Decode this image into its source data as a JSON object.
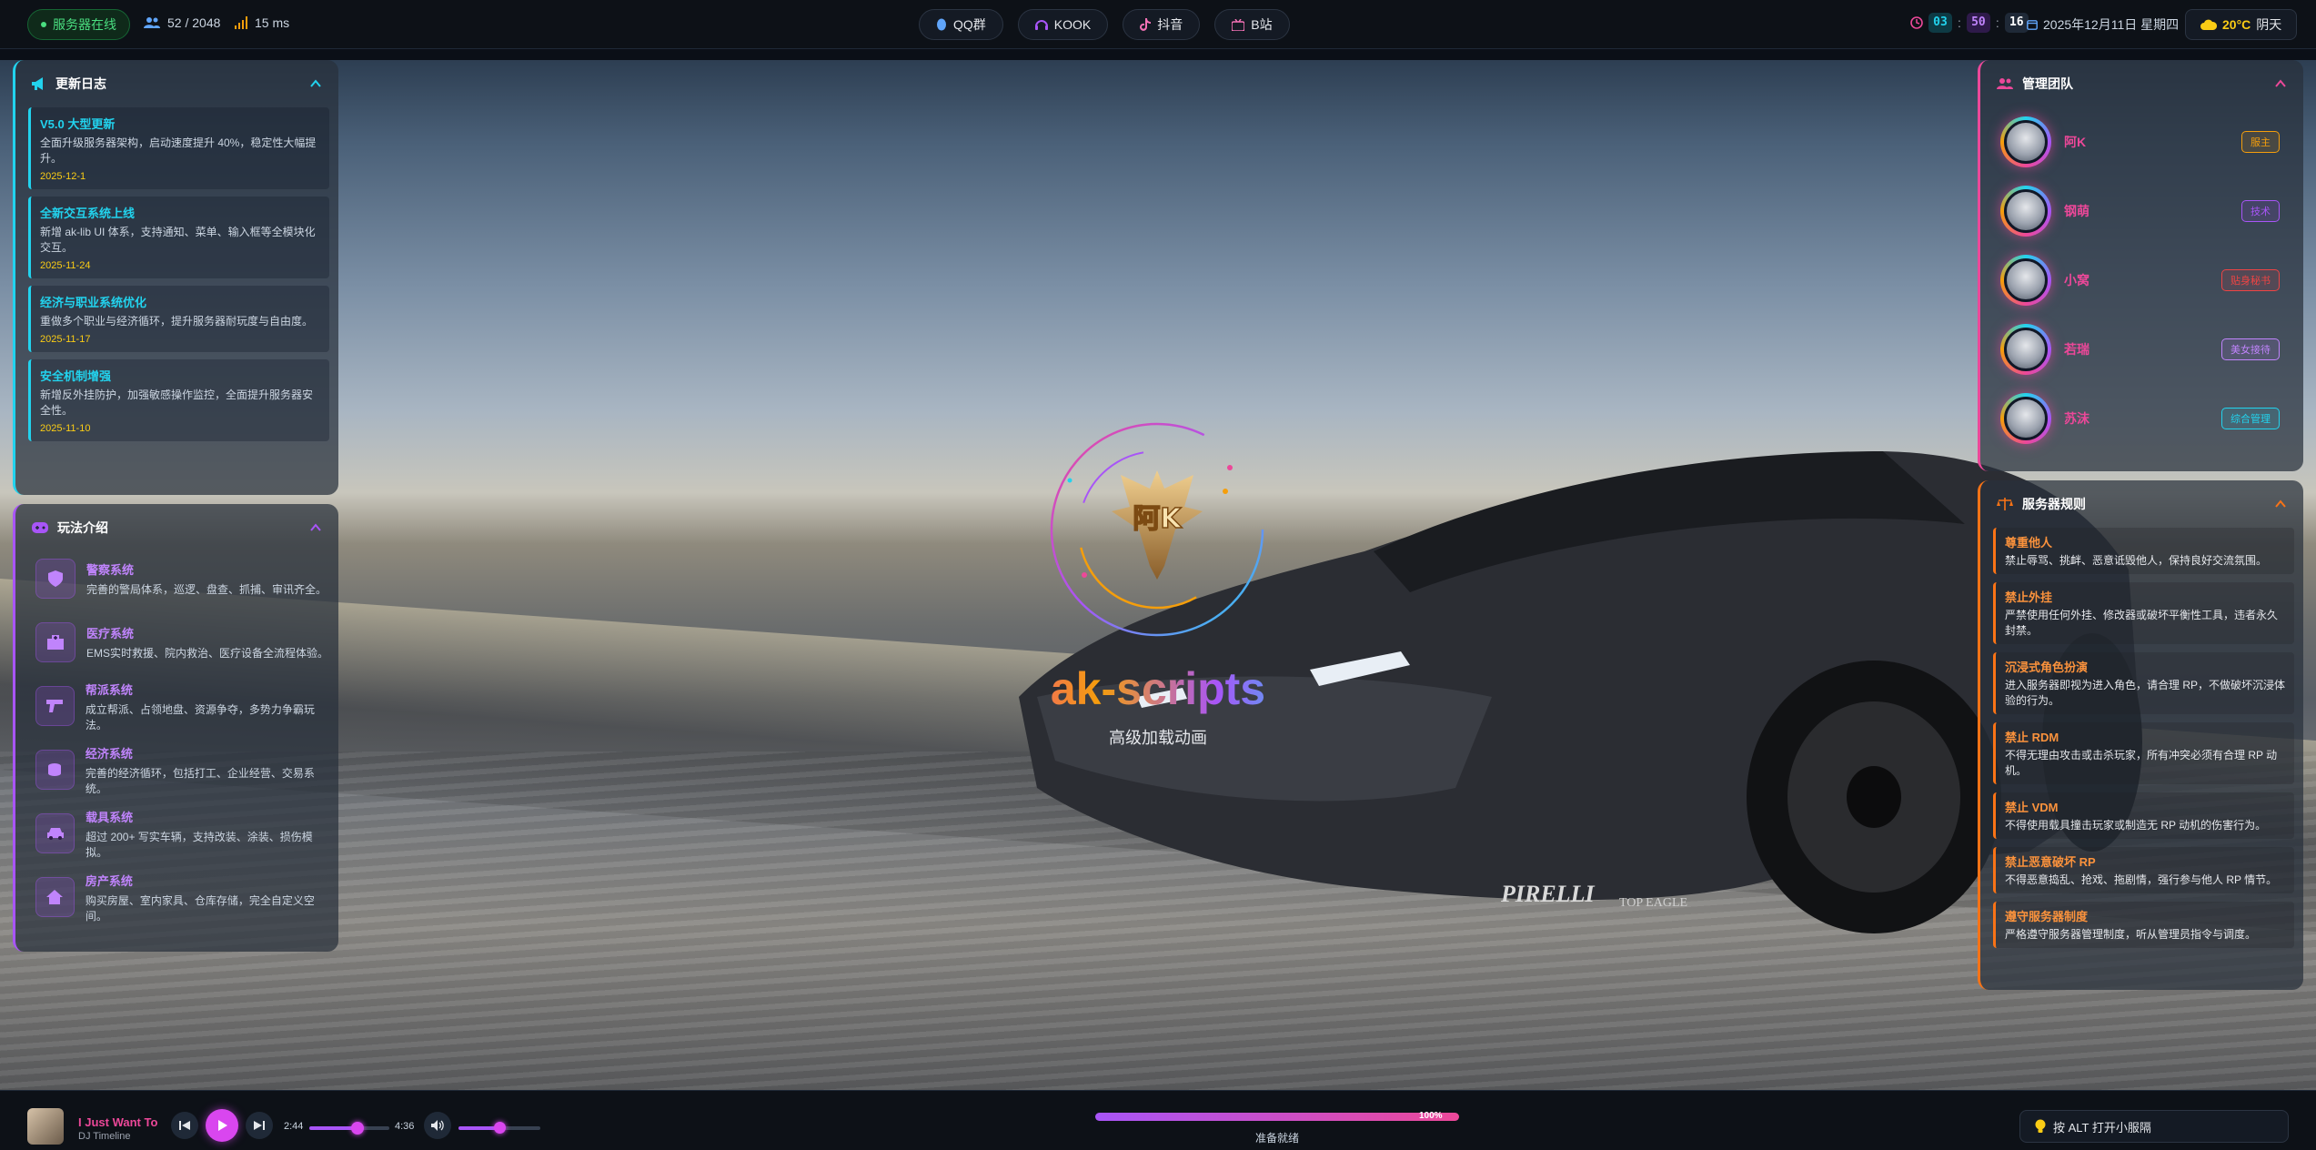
{
  "topbar": {
    "status": "服务器在线",
    "players": "52 / 2048",
    "ping": "15 ms",
    "links": [
      {
        "label": "QQ群"
      },
      {
        "label": "KOOK"
      },
      {
        "label": "抖音"
      },
      {
        "label": "B站"
      }
    ],
    "time": {
      "h": "03",
      "m": "50",
      "s": "16"
    },
    "date": "2025年12月11日 星期四",
    "temp": "20°C",
    "weather": "阴天"
  },
  "changelog": {
    "title": "更新日志",
    "items": [
      {
        "title": "V5.0 大型更新",
        "desc": "全面升级服务器架构，启动速度提升 40%，稳定性大幅提升。",
        "date": "2025-12-1"
      },
      {
        "title": "全新交互系统上线",
        "desc": "新增 ak-lib UI 体系，支持通知、菜单、输入框等全模块化交互。",
        "date": "2025-11-24"
      },
      {
        "title": "经济与职业系统优化",
        "desc": "重做多个职业与经济循环，提升服务器耐玩度与自由度。",
        "date": "2025-11-17"
      },
      {
        "title": "安全机制增强",
        "desc": "新增反外挂防护，加强敏感操作监控，全面提升服务器安全性。",
        "date": "2025-11-10"
      }
    ]
  },
  "gameplay": {
    "title": "玩法介绍",
    "items": [
      {
        "title": "警察系统",
        "desc": "完善的警局体系，巡逻、盘查、抓捕、审讯齐全。",
        "icon": "shield-icon"
      },
      {
        "title": "医疗系统",
        "desc": "EMS实时救援、院内救治、医疗设备全流程体验。",
        "icon": "hospital-icon"
      },
      {
        "title": "帮派系统",
        "desc": "成立帮派、占领地盘、资源争夺，多势力争霸玩法。",
        "icon": "gun-icon"
      },
      {
        "title": "经济系统",
        "desc": "完善的经济循环，包括打工、企业经营、交易系统。",
        "icon": "coins-icon"
      },
      {
        "title": "载具系统",
        "desc": "超过 200+ 写实车辆，支持改装、涂装、损伤模拟。",
        "icon": "car-icon"
      },
      {
        "title": "房产系统",
        "desc": "购买房屋、室内家具、仓库存储，完全自定义空间。",
        "icon": "house-icon"
      }
    ]
  },
  "team": {
    "title": "管理团队",
    "members": [
      {
        "name": "阿K",
        "role": "服主",
        "color": "#f59e0b"
      },
      {
        "name": "钢萌",
        "role": "技术",
        "color": "#a855f7"
      },
      {
        "name": "小窝",
        "role": "贴身秘书",
        "color": "#ef4444"
      },
      {
        "name": "若瑞",
        "role": "美女接待",
        "color": "#c084fc"
      },
      {
        "name": "苏沫",
        "role": "综合管理",
        "color": "#22d3ee"
      }
    ]
  },
  "rules": {
    "title": "服务器规则",
    "items": [
      {
        "title": "尊重他人",
        "desc": "禁止辱骂、挑衅、恶意诋毁他人，保持良好交流氛围。"
      },
      {
        "title": "禁止外挂",
        "desc": "严禁使用任何外挂、修改器或破坏平衡性工具，违者永久封禁。"
      },
      {
        "title": "沉浸式角色扮演",
        "desc": "进入服务器即视为进入角色，请合理 RP，不做破坏沉浸体验的行为。"
      },
      {
        "title": "禁止 RDM",
        "desc": "不得无理由攻击或击杀玩家，所有冲突必须有合理 RP 动机。"
      },
      {
        "title": "禁止 VDM",
        "desc": "不得使用载具撞击玩家或制造无 RP 动机的伤害行为。"
      },
      {
        "title": "禁止恶意破坏 RP",
        "desc": "不得恶意捣乱、抢戏、拖剧情，强行参与他人 RP 情节。"
      },
      {
        "title": "遵守服务器制度",
        "desc": "严格遵守服务器管理制度，听从管理员指令与调度。"
      }
    ]
  },
  "center": {
    "logo_text": "阿K",
    "brand": "ak-scripts",
    "subtitle": "高级加载动画"
  },
  "player": {
    "song": "I Just Want To",
    "artist": "DJ Timeline",
    "current": "2:44",
    "total": "4:36",
    "progress": 0.6,
    "volume": 0.5
  },
  "loading": {
    "percent": "100%",
    "text": "准备就绪",
    "progress": 1.0
  },
  "hint": "按 ALT 打开小服隔"
}
